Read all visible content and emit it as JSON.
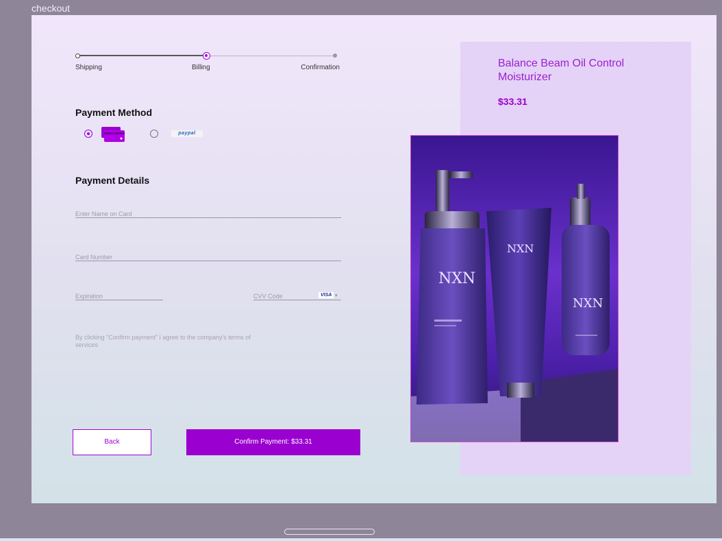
{
  "window": {
    "title": "checkout"
  },
  "stepper": {
    "steps": [
      {
        "label": "Shipping",
        "state": "done"
      },
      {
        "label": "Billing",
        "state": "active"
      },
      {
        "label": "Confirmation",
        "state": "pending"
      }
    ]
  },
  "payment_method": {
    "title": "Payment Method",
    "options": [
      {
        "name": "card",
        "icon": "credit-card-icon",
        "selected": true
      },
      {
        "name": "paypal",
        "logo_text": "paypal",
        "selected": false
      }
    ]
  },
  "payment_details": {
    "title": "Payment Details",
    "name_placeholder": "Enter Name on Card",
    "number_placeholder": "Card Number",
    "expiration_placeholder": "Expiration",
    "cvv_placeholder": "CVV Code",
    "card_brand": "VISA"
  },
  "terms_text": "By clicking \"Confirm payment\" I agree to the company's terms of services",
  "buttons": {
    "back": "Back",
    "confirm": "Confirm Payment: $33.31"
  },
  "product": {
    "name": "Balance Beam Oil Control Moisturizer",
    "price": "$33.31",
    "image_logo": "NXN"
  },
  "colors": {
    "accent": "#9a00cf",
    "summary_bg": "#e5d2f7",
    "frame_bg": "#8e8598"
  }
}
